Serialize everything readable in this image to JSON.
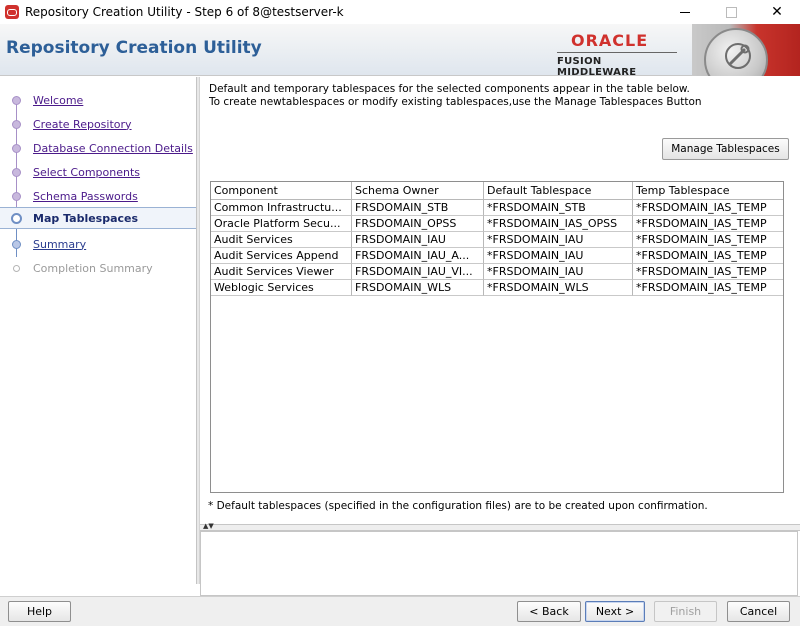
{
  "window": {
    "title": "Repository Creation Utility - Step 6 of 8@testserver-k",
    "minimize": "—",
    "maximize": "☐",
    "close": "✕"
  },
  "header": {
    "app_title": "Repository Creation Utility",
    "logo_word": "ORACLE",
    "logo_sub": "FUSION MIDDLEWARE",
    "brand_color": "#d0312d",
    "title_color": "#2d5f98"
  },
  "nav": {
    "items": [
      {
        "label": "Welcome",
        "state": "done"
      },
      {
        "label": "Create Repository",
        "state": "done"
      },
      {
        "label": "Database Connection Details",
        "state": "done"
      },
      {
        "label": "Select Components",
        "state": "done"
      },
      {
        "label": "Schema Passwords",
        "state": "done"
      },
      {
        "label": "Map Tablespaces",
        "state": "active"
      },
      {
        "label": "Summary",
        "state": "next"
      },
      {
        "label": "Completion Summary",
        "state": "disabled"
      }
    ]
  },
  "content": {
    "intro_line1": "Default and temporary tablespaces for the selected components appear in the table below.",
    "intro_line2": "To create newtablespaces or modify existing tablespaces,use the Manage Tablespaces Button",
    "manage_button": "Manage Tablespaces",
    "table": {
      "columns": [
        "Component",
        "Schema Owner",
        "Default Tablespace",
        "Temp Tablespace"
      ],
      "rows": [
        [
          "Common Infrastructu...",
          "FRSDOMAIN_STB",
          "*FRSDOMAIN_STB",
          "*FRSDOMAIN_IAS_TEMP"
        ],
        [
          "Oracle Platform Secu...",
          "FRSDOMAIN_OPSS",
          "*FRSDOMAIN_IAS_OPSS",
          "*FRSDOMAIN_IAS_TEMP"
        ],
        [
          "Audit Services",
          "FRSDOMAIN_IAU",
          "*FRSDOMAIN_IAU",
          "*FRSDOMAIN_IAS_TEMP"
        ],
        [
          "Audit Services Append",
          "FRSDOMAIN_IAU_A...",
          "*FRSDOMAIN_IAU",
          "*FRSDOMAIN_IAS_TEMP"
        ],
        [
          "Audit Services Viewer",
          "FRSDOMAIN_IAU_VI...",
          "*FRSDOMAIN_IAU",
          "*FRSDOMAIN_IAS_TEMP"
        ],
        [
          "Weblogic Services",
          "FRSDOMAIN_WLS",
          "*FRSDOMAIN_WLS",
          "*FRSDOMAIN_IAS_TEMP"
        ]
      ]
    },
    "footnote": "* Default tablespaces (specified in the configuration files) are to be created upon confirmation."
  },
  "buttons": {
    "help": "Help",
    "back": "< Back",
    "next": "Next >",
    "finish": "Finish",
    "cancel": "Cancel"
  }
}
